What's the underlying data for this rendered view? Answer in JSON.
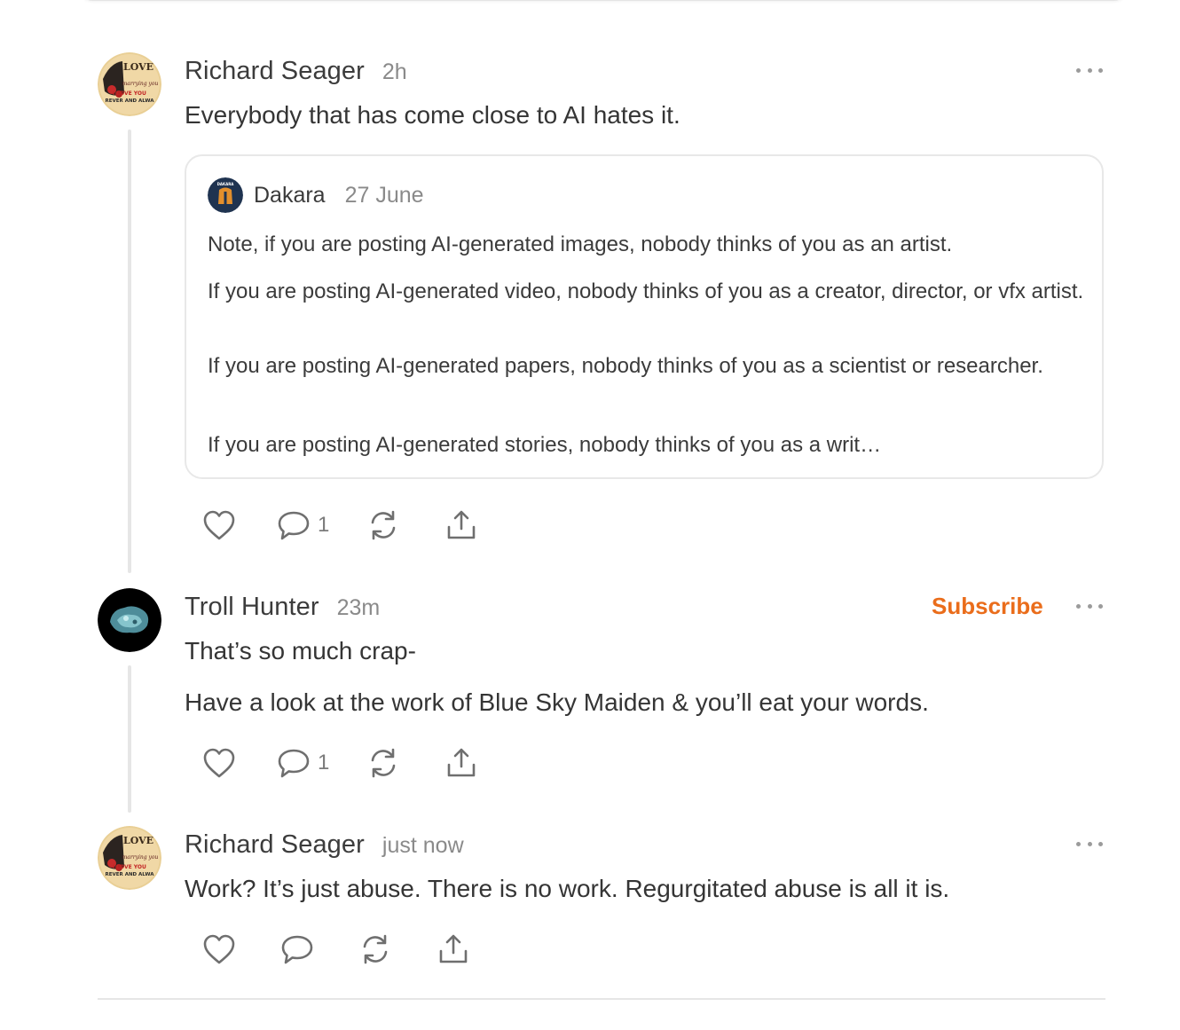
{
  "comments": [
    {
      "author": "Richard Seager",
      "time": "2h",
      "text": "Everybody that has come close to AI hates it.",
      "quote": {
        "author": "Dakara",
        "avatar_text": "DAKARA",
        "time": "27 June",
        "paragraphs": [
          "Note, if you are posting AI-generated images, nobody thinks of you as an artist.",
          "If you are posting AI-generated video, nobody thinks of you as a creator, director, or vfx artist.",
          "If you are posting AI-generated papers, nobody thinks of you as a scientist or researcher.",
          "If you are posting AI-generated stories, nobody thinks of you as a writ…"
        ]
      },
      "reply_count": "1"
    },
    {
      "author": "Troll Hunter",
      "time": "23m",
      "subscribe_label": "Subscribe",
      "paragraphs": [
        "That’s so much crap-",
        "Have a look at the work of Blue Sky Maiden & you’ll eat your words."
      ],
      "reply_count": "1"
    },
    {
      "author": "Richard Seager",
      "time": "just now",
      "text": "Work? It’s just abuse. There is no work. Regurgitated abuse is all it is."
    }
  ],
  "avatar_art": {
    "lines": [
      "LOVE",
      "marrying you",
      "I LOVE YOU",
      "REVER AND ALWA"
    ]
  },
  "icons": [
    "heart-icon",
    "comment-icon",
    "restack-icon",
    "share-icon",
    "more-icon"
  ],
  "colors": {
    "accent": "#ea6d1b",
    "text": "#363737",
    "muted": "#8a8a8a",
    "thread_line": "#e6e6e6"
  }
}
